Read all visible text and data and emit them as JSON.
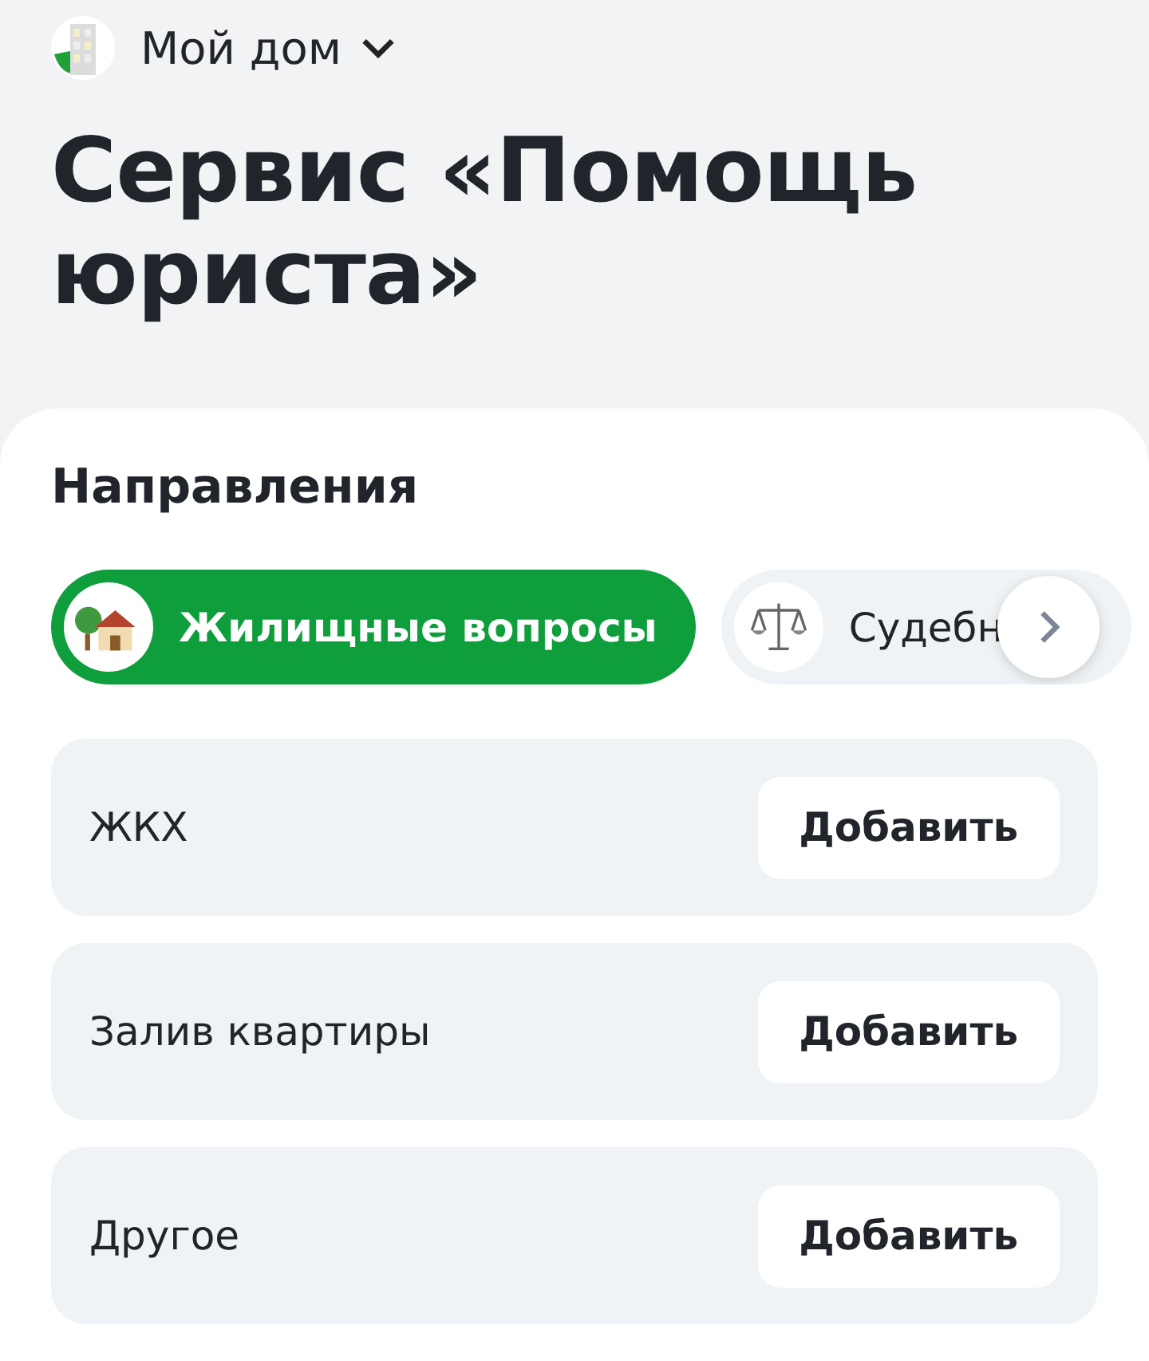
{
  "header": {
    "home": "Мой дом"
  },
  "title": "Сервис «Помощь юриста»",
  "section": "Направления",
  "chips": [
    {
      "label": "Жилищные вопросы",
      "kind": "house",
      "selected": true
    },
    {
      "label": "Судебн",
      "kind": "scales",
      "selected": false
    }
  ],
  "items": [
    {
      "label": "ЖКХ",
      "button": "Добавить"
    },
    {
      "label": "Залив квартиры",
      "button": "Добавить"
    },
    {
      "label": "Другое",
      "button": "Добавить"
    }
  ]
}
